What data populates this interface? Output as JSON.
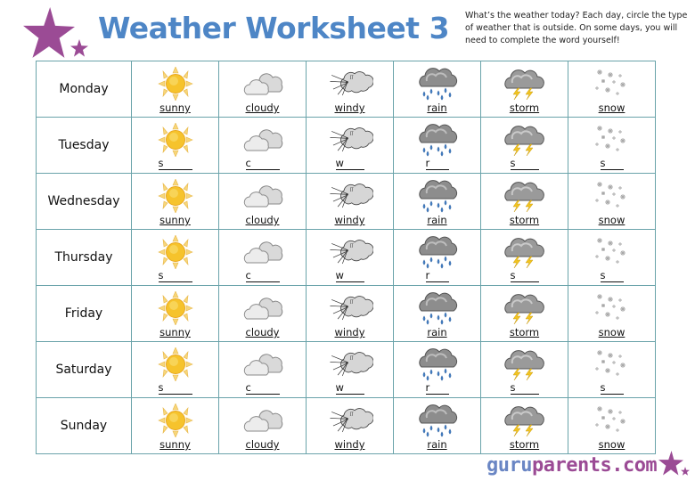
{
  "header": {
    "title": "Weather Worksheet 3",
    "instructions": "What’s the weather today? Each day, circle the type of weather that is outside. On some days, you will need to complete the word yourself!"
  },
  "colors": {
    "title": "#4e86c6",
    "star": "#9b4b95",
    "grid": "#6aa3aa"
  },
  "weather_types": [
    {
      "key": "sunny",
      "icon": "sun-icon"
    },
    {
      "key": "cloudy",
      "icon": "cloud-icon"
    },
    {
      "key": "windy",
      "icon": "wind-cloud-icon"
    },
    {
      "key": "rain",
      "icon": "rain-cloud-icon"
    },
    {
      "key": "storm",
      "icon": "storm-cloud-icon"
    },
    {
      "key": "snow",
      "icon": "snowflakes-icon"
    }
  ],
  "rows": [
    {
      "day": "Monday",
      "mode": "word",
      "cells": [
        "sunny",
        "cloudy",
        "windy",
        "rain",
        "storm",
        "snow"
      ]
    },
    {
      "day": "Tuesday",
      "mode": "blank",
      "cells": [
        "s",
        "c",
        "w",
        "r",
        "s",
        "s"
      ]
    },
    {
      "day": "Wednesday",
      "mode": "word",
      "cells": [
        "sunny",
        "cloudy",
        "windy",
        "rain",
        "storm",
        "snow"
      ]
    },
    {
      "day": "Thursday",
      "mode": "blank",
      "cells": [
        "s",
        "c",
        "w",
        "r",
        "s",
        "s"
      ]
    },
    {
      "day": "Friday",
      "mode": "word",
      "cells": [
        "sunny",
        "cloudy",
        "windy",
        "rain",
        "storm",
        "snow"
      ]
    },
    {
      "day": "Saturday",
      "mode": "blank",
      "cells": [
        "s",
        "c",
        "w",
        "r",
        "s",
        "s"
      ]
    },
    {
      "day": "Sunday",
      "mode": "word",
      "cells": [
        "sunny",
        "cloudy",
        "windy",
        "rain",
        "storm",
        "snow"
      ]
    }
  ],
  "footer": {
    "logo_part1": "guru",
    "logo_part2": "parents.com"
  }
}
